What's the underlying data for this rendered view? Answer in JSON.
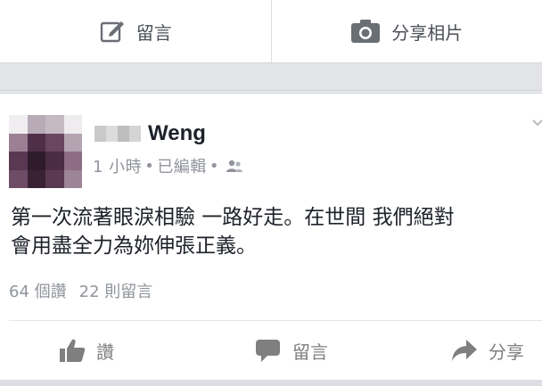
{
  "composer": {
    "post_label": "留言",
    "photo_label": "分享相片",
    "icons": [
      "edit-icon",
      "camera-icon"
    ]
  },
  "post": {
    "author_name": "Weng",
    "meta": {
      "time": "1 小時",
      "edited": "已編輯",
      "separator": "•",
      "audience_icon": "friends-icon"
    },
    "text_lines": [
      "第一次流著眼淚相驗 一路好走。在世間 我們絕對",
      "會用盡全力為妳伸張正義。"
    ],
    "likes_label": "64 個讚",
    "comments_label": "22 則留言",
    "more_icon": "chevron-down-icon"
  },
  "actions": {
    "like_label": "讚",
    "comment_label": "留言",
    "share_label": "分享",
    "icons": [
      "thumbs-up-icon",
      "comment-bubble-icon",
      "share-arrow-icon"
    ]
  },
  "colors": {
    "background": "#e9eaed",
    "card": "#ffffff",
    "text_primary": "#1d2129",
    "text_secondary": "#90949c",
    "icon_gray": "#7f7f7f"
  }
}
